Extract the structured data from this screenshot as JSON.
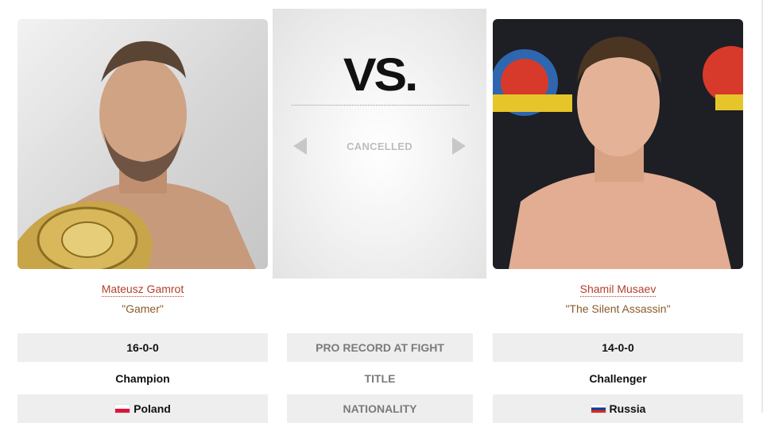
{
  "fight": {
    "vs_label": "VS.",
    "status": "CANCELLED"
  },
  "fighter_left": {
    "name": "Mateusz Gamrot",
    "nickname": "\"Gamer\"",
    "record": "16-0-0",
    "title": "Champion",
    "nationality": "Poland",
    "flag": "flag-poland-icon"
  },
  "fighter_right": {
    "name": "Shamil Musaev",
    "nickname": "\"The Silent Assassin\"",
    "record": "14-0-0",
    "title": "Challenger",
    "nationality": "Russia",
    "flag": "flag-russia-icon"
  },
  "labels": {
    "record": "PRO RECORD AT FIGHT",
    "title": "TITLE",
    "nationality": "NATIONALITY"
  },
  "colors": {
    "name_link": "#b3402a",
    "nickname": "#8a5a2b",
    "row_shade": "#eeeeee"
  }
}
